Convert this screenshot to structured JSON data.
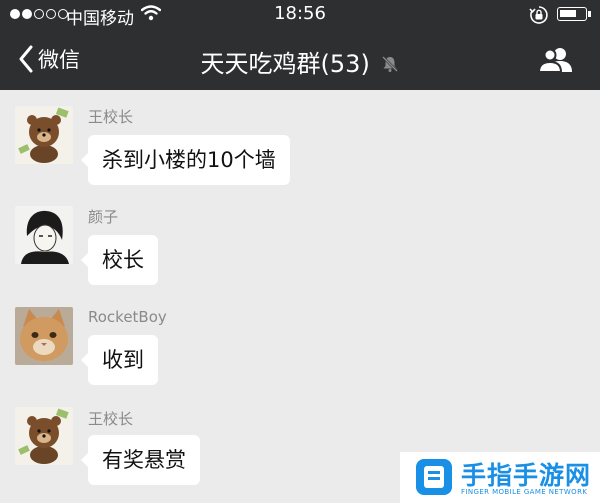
{
  "status_bar": {
    "carrier": "中国移动",
    "time": "18:56"
  },
  "nav": {
    "back_label": "微信",
    "title": "天天吃鸡群(53)"
  },
  "messages": [
    {
      "sender": "王校长",
      "text": "杀到小楼的10个墙",
      "avatar": "brown-bear-sticker"
    },
    {
      "sender": "颜子",
      "text": "校长",
      "avatar": "ink-sketch-portrait"
    },
    {
      "sender": "RocketBoy",
      "text": "收到",
      "avatar": "orange-cat-photo"
    },
    {
      "sender": "王校长",
      "text": "有奖悬赏",
      "avatar": "brown-bear-sticker"
    }
  ],
  "watermark": {
    "name": "手指手游网",
    "tagline": "FINGER MOBILE GAME NETWORK"
  },
  "colors": {
    "header_bg": "#2e2f31",
    "chat_bg": "#ebebeb",
    "bubble_bg": "#ffffff",
    "watermark_blue": "#1a8fe6"
  }
}
